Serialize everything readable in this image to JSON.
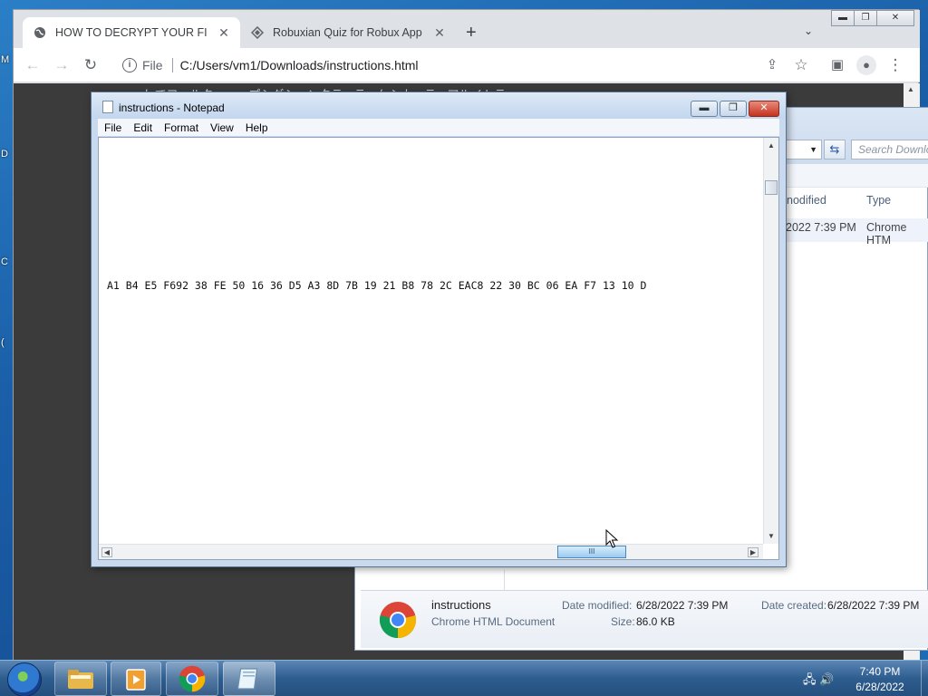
{
  "desktop": {
    "edge_letters": [
      "M",
      "D",
      "C",
      "("
    ]
  },
  "browser": {
    "tabs": [
      {
        "label": "HOW TO DECRYPT YOUR FILES",
        "active": true
      },
      {
        "label": "Robuxian Quiz for Robux App Ra",
        "active": false
      }
    ],
    "new_tab": "+",
    "url_scheme": "File",
    "url": "C:/Users/vm1/Downloads/instructions.html",
    "page_text": "、してフィルター、、、プシグシァンタティラーケシカ、ティアルイトティ。。"
  },
  "notepad": {
    "title": "instructions - Notepad",
    "menu": [
      "File",
      "Edit",
      "Format",
      "View",
      "Help"
    ],
    "content_line": "A1 B4 E5 F692 38 FE 50 16 36 D5 A3 8D 7B 19 21 B8 78 2C EAC8 22 30 BC 06 EA F7 13 10 D",
    "scroll_thumb_label": "III"
  },
  "explorer": {
    "search_placeholder": "Search Downloads",
    "columns": [
      "nodified",
      "Type"
    ],
    "row": {
      "date": "2022 7:39 PM",
      "type": "Chrome HTM"
    },
    "details": {
      "name": "instructions",
      "kind": "Chrome HTML Document",
      "date_modified_label": "Date modified:",
      "date_modified": "6/28/2022 7:39 PM",
      "size_label": "Size:",
      "size": "86.0 KB",
      "date_created_label": "Date created:",
      "date_created": "6/28/2022 7:39 PM"
    }
  },
  "taskbar": {
    "time": "7:40 PM",
    "date": "6/28/2022",
    "pinned": [
      "folder-icon",
      "media-player-icon",
      "chrome-icon",
      "notepad-icon"
    ]
  },
  "colors": {
    "tab_bg": "#dee1e6",
    "page_bg": "#3b3b3b",
    "notepad_frame": "#c9daef",
    "taskbar": "#2e5d8f"
  }
}
